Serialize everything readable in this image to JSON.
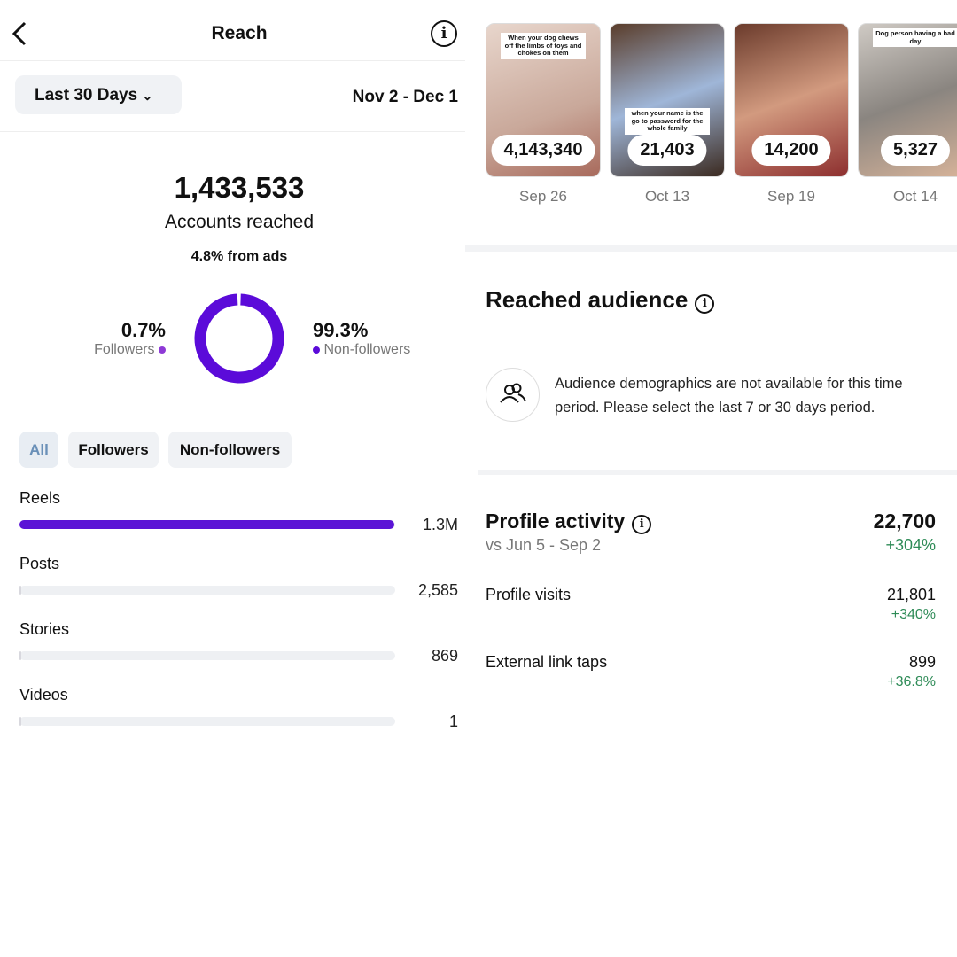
{
  "header": {
    "title": "Reach",
    "back_icon": "chevron-left-icon",
    "info_icon": "info-icon"
  },
  "filter": {
    "range_label": "Last 30 Days",
    "date_range": "Nov 2 - Dec 1"
  },
  "summary": {
    "accounts_reached": "1,433,533",
    "accounts_reached_label": "Accounts reached",
    "from_ads": "4.8% from ads"
  },
  "donut": {
    "followers_pct": "0.7%",
    "followers_label": "Followers",
    "followers_fraction": 0.007,
    "nonfollowers_pct": "99.3%",
    "nonfollowers_label": "Non-followers",
    "colors": {
      "followers": "#8e3ad6",
      "nonfollowers": "#5b0bd9"
    }
  },
  "tabs": [
    {
      "label": "All",
      "active": true
    },
    {
      "label": "Followers"
    },
    {
      "label": "Non-followers"
    }
  ],
  "content_types": [
    {
      "label": "Reels",
      "value": "1.3M",
      "fraction": 0.998
    },
    {
      "label": "Posts",
      "value": "2,585",
      "fraction": 0.004
    },
    {
      "label": "Stories",
      "value": "869",
      "fraction": 0.002
    },
    {
      "label": "Videos",
      "value": "1",
      "fraction": 0.0
    }
  ],
  "top_content": [
    {
      "count": "4,143,340",
      "date": "Sep 26",
      "caption": "When your dog chews off the limbs of toys and chokes on them"
    },
    {
      "count": "21,403",
      "date": "Oct 13",
      "caption": "when your name is the go to password for the whole family"
    },
    {
      "count": "14,200",
      "date": "Sep 19",
      "caption": ""
    },
    {
      "count": "5,327",
      "date": "Oct 14",
      "caption": "Dog person having a bad day"
    }
  ],
  "reached_audience": {
    "title": "Reached audience",
    "icon": "people-icon",
    "message": "Audience demographics are not available for this time period. Please select the last 7 or 30 days period."
  },
  "profile_activity": {
    "title": "Profile activity",
    "compare": "vs Jun 5 - Sep 2",
    "total": "22,700",
    "total_change": "+304%",
    "rows": [
      {
        "label": "Profile visits",
        "value": "21,801",
        "change": "+340%"
      },
      {
        "label": "External link taps",
        "value": "899",
        "change": "+36.8%"
      }
    ]
  }
}
